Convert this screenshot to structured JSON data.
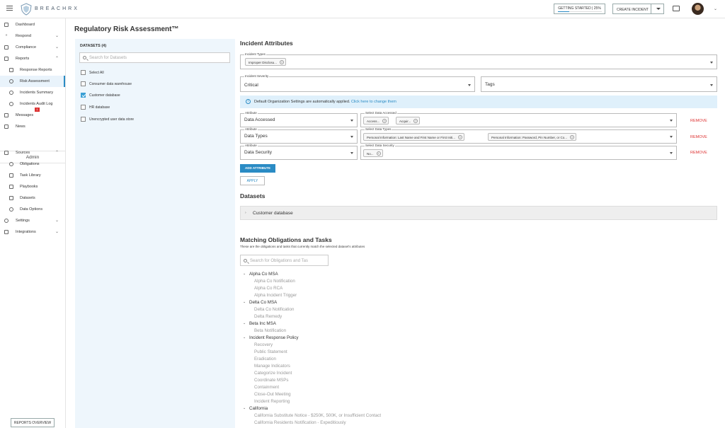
{
  "topbar": {
    "brand": "BREACHRX",
    "getting_started": "GETTING STARTED | 25%",
    "getting_started_progress": 0.25,
    "create_incident": "CREATE INCIDENT"
  },
  "sidebar": {
    "items": [
      {
        "label": "Dashboard",
        "icon": "grid-icon"
      },
      {
        "label": "Respond",
        "icon": "double-chevron-icon",
        "chevron": "⌄"
      },
      {
        "label": "Compliance",
        "icon": "checkbox-icon",
        "chevron": "⌄"
      },
      {
        "label": "Reports",
        "icon": "report-icon",
        "chevron": "⌃"
      },
      {
        "label": "Response Reports",
        "icon": "document-icon"
      },
      {
        "label": "Risk Assessment",
        "icon": "gauge-icon"
      },
      {
        "label": "Incidents Summary",
        "icon": "pie-icon"
      },
      {
        "label": "Incidents Audit Log",
        "icon": "clock-icon"
      },
      {
        "label": "Messages",
        "icon": "mail-icon",
        "badge": "1"
      },
      {
        "label": "News",
        "icon": "news-icon"
      }
    ],
    "admin_label": "Admin",
    "admin_items": [
      {
        "label": "Sources",
        "icon": "home-icon",
        "chevron": "⌃"
      },
      {
        "label": "Obligations",
        "icon": "globe-icon"
      },
      {
        "label": "Task Library",
        "icon": "list-icon"
      },
      {
        "label": "Playbooks",
        "icon": "book-icon"
      },
      {
        "label": "Datasets",
        "icon": "table-icon"
      },
      {
        "label": "Data Options",
        "icon": "link-icon"
      },
      {
        "label": "Settings",
        "icon": "gear-icon",
        "chevron": "⌄"
      },
      {
        "label": "Integrations",
        "icon": "plug-icon",
        "chevron": "⌄"
      }
    ],
    "reports_overview": "REPORTS OVERVIEW"
  },
  "page_title": "Regulatory Risk Assessment™",
  "datasets_panel": {
    "header": "DATASETS (4)",
    "search_placeholder": "Search for Datasets",
    "rows": [
      {
        "label": "Select All",
        "checked": false
      },
      {
        "label": "Consumer data warehouse",
        "checked": false
      },
      {
        "label": "Customer database",
        "checked": true
      },
      {
        "label": "HR database",
        "checked": false
      },
      {
        "label": "Unencrypted user data store",
        "checked": false
      }
    ]
  },
  "incident_attributes": {
    "title": "Incident Attributes",
    "incident_types_label": "Incident Types",
    "incident_types_chip": "Improper Disclosu...",
    "severity_label": "Incident Severity",
    "severity_value": "Critical",
    "tags_placeholder": "Tags",
    "info_text": "Default Organization Settings are automatically applied.",
    "info_link": "Click here to change them",
    "attribute_label": "Attribute",
    "remove_label": "REMOVE",
    "attributes": [
      {
        "value": "Data Accessed",
        "select_label": "Select Data Accessed",
        "chips": [
          "Access...",
          "Acquir..."
        ]
      },
      {
        "value": "Data Types",
        "select_label": "Select Data Types",
        "chips": [
          "Personal Information: Last Name and First Name or First Initi...",
          "Personal Information: Password, Pin Number, or Co..."
        ]
      },
      {
        "value": "Data Security",
        "select_label": "Select Data Security",
        "chips": [
          "No..."
        ]
      }
    ],
    "add_attribute": "ADD ATTRIBUTE",
    "apply": "APPLY"
  },
  "datasets_section": {
    "title": "Datasets",
    "row": "Customer database"
  },
  "matching": {
    "title": "Matching Obligations and Tasks",
    "description": "These are the obligations and tasks that currently match the selected dataset's attributes",
    "search_placeholder": "Search for Obligations and Tas",
    "groups": [
      {
        "name": "Alpha Co MSA",
        "items": [
          "Alpha Co Notification",
          "Alpha Co RCA",
          "Alpha Incident Trigger"
        ]
      },
      {
        "name": "Delta Co MSA",
        "items": [
          "Delta Co Notification",
          "Delta Remedy"
        ]
      },
      {
        "name": "Beta Inc MSA",
        "items": [
          "Beta Notification"
        ]
      },
      {
        "name": "Incident Response Policy",
        "items": [
          "Recovery",
          "Public Statement",
          "Eradication",
          "Manage Indicators",
          "Categorize Incident",
          "Coordinate MSPs",
          "Containment",
          "Close-Out Meeting",
          "Incident Reporting"
        ]
      },
      {
        "name": "California",
        "items": [
          "California Substitute Notice - $250K, 500K, or Insufficient Contact",
          "California Residents Notification - Expeditiously"
        ]
      }
    ]
  }
}
